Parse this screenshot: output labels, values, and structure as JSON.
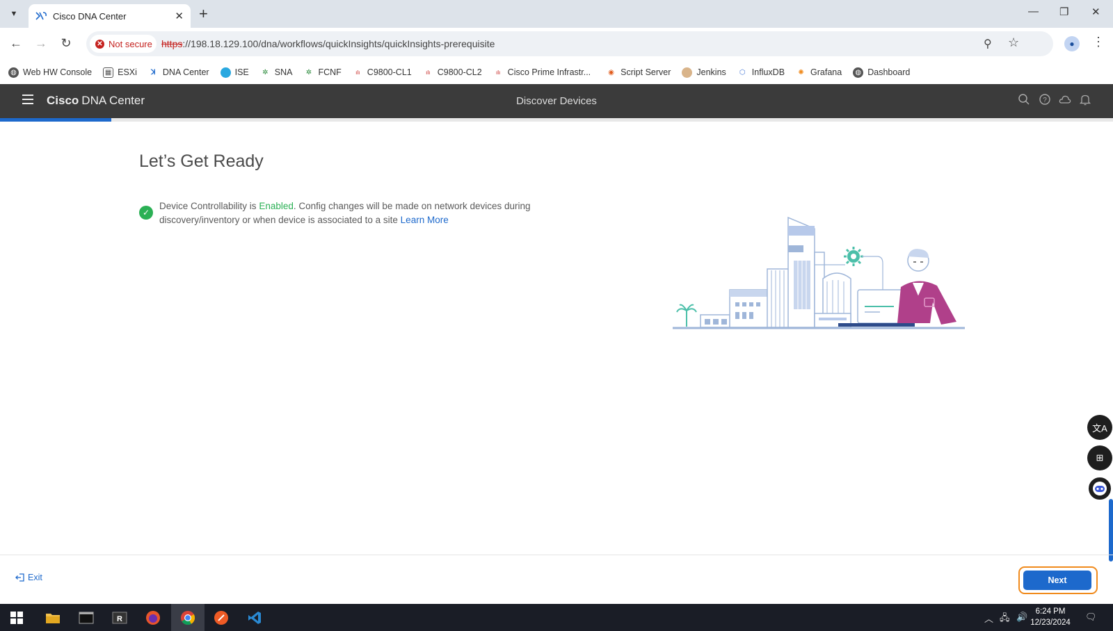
{
  "browser": {
    "tab_title": "Cisco DNA Center",
    "tab_close": "✕",
    "new_tab": "+",
    "security_label": "Not secure",
    "url_scheme": "https",
    "url_rest": "://198.18.129.100/dna/workflows/quickInsights/quickInsights-prerequisite"
  },
  "bookmarks": [
    "Web HW Console",
    "ESXi",
    "DNA Center",
    "ISE",
    "SNA",
    "FCNF",
    "C9800-CL1",
    "C9800-CL2",
    "Cisco Prime Infrastr...",
    "Script Server",
    "Jenkins",
    "InfluxDB",
    "Grafana",
    "Dashboard"
  ],
  "app": {
    "brand_bold": "Cisco",
    "brand_rest": "DNA Center",
    "page_title": "Discover Devices",
    "progress": 0.1
  },
  "content": {
    "heading": "Let’s Get Ready",
    "status_prefix": "Device Controllability is ",
    "status_state": "Enabled",
    "status_suffix": ". Config changes will be made on network devices during discovery/inventory or when device is associated to a site ",
    "learn_more": "Learn More"
  },
  "footer": {
    "exit_label": "Exit",
    "next_label": "Next"
  },
  "taskbar": {
    "time": "6:24 PM",
    "date": "12/23/2024"
  },
  "colors": {
    "accent": "#1d69cc",
    "success": "#2bb055",
    "highlight": "#f08a1c",
    "header_bg": "#3b3b3b"
  }
}
